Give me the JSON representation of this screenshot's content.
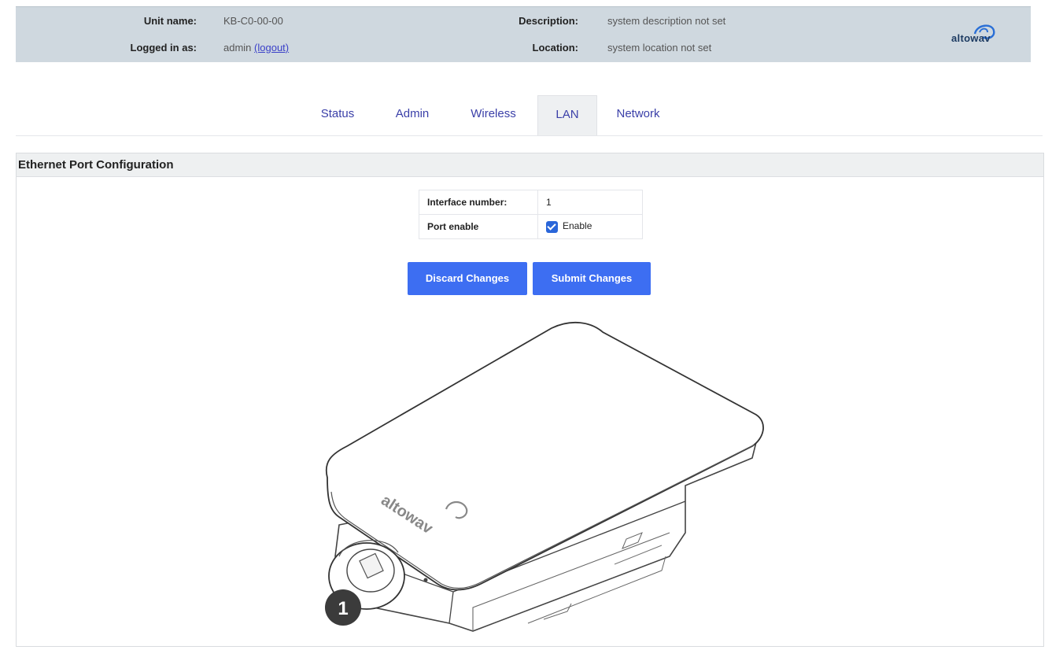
{
  "header": {
    "unit_name_label": "Unit name:",
    "unit_name_value": "KB-C0-00-00",
    "logged_in_label": "Logged in as:",
    "logged_in_user": "admin",
    "logout_text": "(logout)",
    "description_label": "Description:",
    "description_value": "system description not set",
    "location_label": "Location:",
    "location_value": "system location not set",
    "logo_text": "altowav"
  },
  "tabs": [
    {
      "label": "Status",
      "active": false
    },
    {
      "label": "Admin",
      "active": false
    },
    {
      "label": "Wireless",
      "active": false
    },
    {
      "label": "LAN",
      "active": true
    },
    {
      "label": "Network",
      "active": false
    }
  ],
  "panel": {
    "title": "Ethernet Port Configuration",
    "interface_label": "Interface number:",
    "interface_value": "1",
    "port_enable_label": "Port enable",
    "enable_checkbox_label": "Enable",
    "enable_checked": true,
    "discard_button": "Discard Changes",
    "submit_button": "Submit Changes"
  },
  "device": {
    "logo_text": "altowav",
    "port_badge": "1"
  },
  "colors": {
    "header_bg": "#cfd8df",
    "button_bg": "#3d6ef2",
    "tab_text": "#3a3fa8",
    "checkbox": "#2a66d9"
  }
}
